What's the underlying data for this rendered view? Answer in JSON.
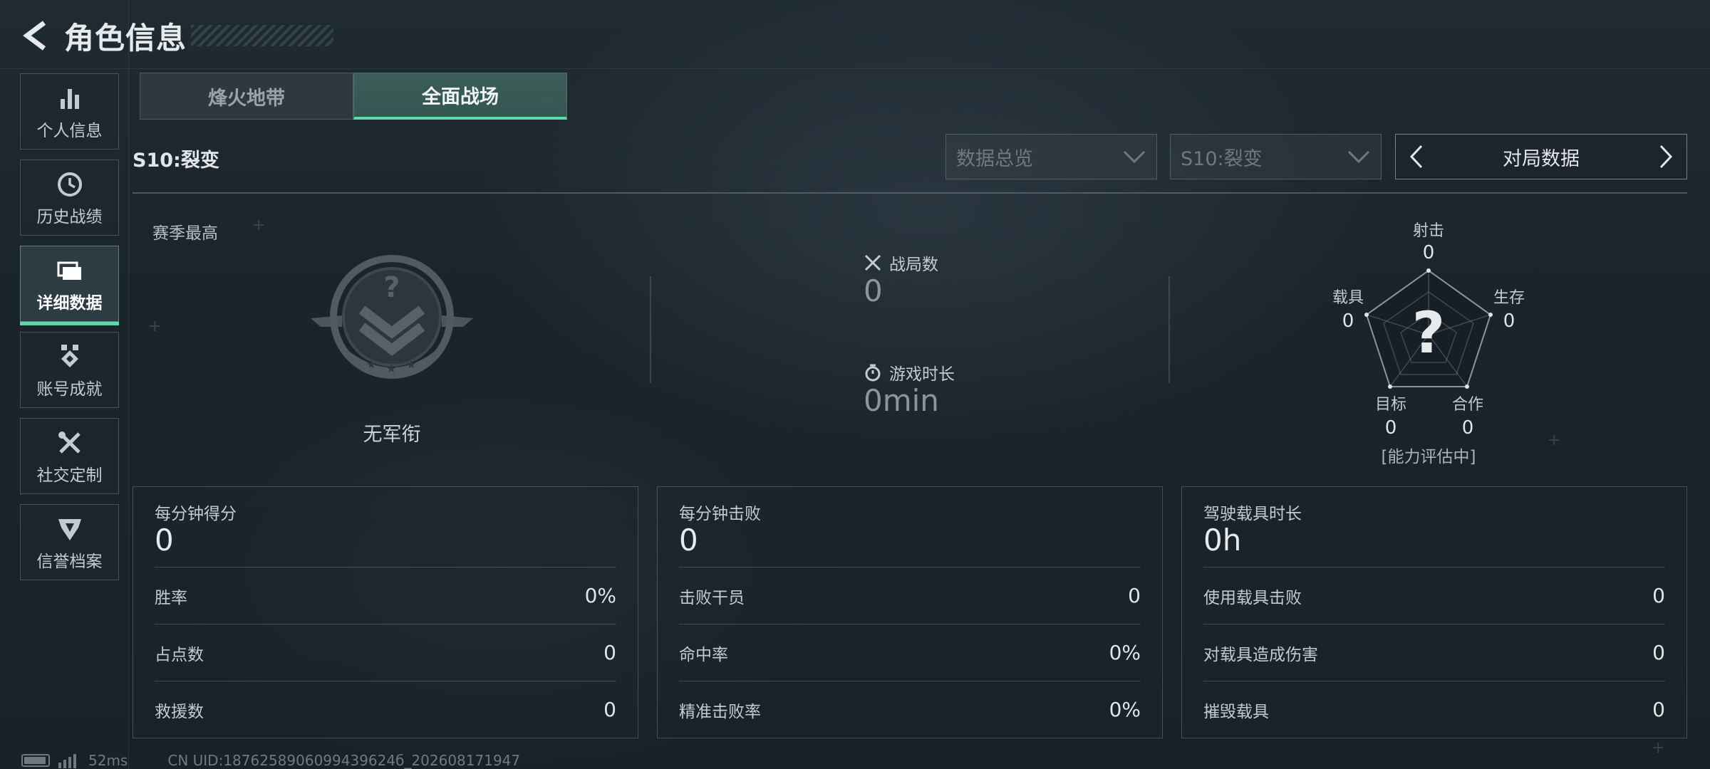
{
  "header": {
    "title": "角色信息"
  },
  "sidebar": {
    "items": [
      {
        "label": "个人信息"
      },
      {
        "label": "历史战绩"
      },
      {
        "label": "详细数据"
      },
      {
        "label": "账号成就"
      },
      {
        "label": "社交定制"
      },
      {
        "label": "信誉档案"
      }
    ],
    "active_index": 2
  },
  "tabs": [
    {
      "label": "烽火地带"
    },
    {
      "label": "全面战场"
    }
  ],
  "active_tab": 1,
  "season": {
    "label": "S10:裂变",
    "dropdown_overview": "数据总览",
    "dropdown_season": "S10:裂变",
    "match_data_label": "对局数据"
  },
  "overview": {
    "season_high_label": "赛季最高",
    "rank_name": "无军衔",
    "battles_label": "战局数",
    "battles_value": "0",
    "playtime_label": "游戏时长",
    "playtime_value": "0min"
  },
  "radar": {
    "shooting_label": "射击",
    "shooting_value": "0",
    "survival_label": "生存",
    "survival_value": "0",
    "teamwork_label": "合作",
    "teamwork_value": "0",
    "objective_label": "目标",
    "objective_value": "0",
    "vehicle_label": "载具",
    "vehicle_value": "0",
    "center_symbol": "?",
    "status": "[能力评估中]"
  },
  "cards": [
    {
      "title": "每分钟得分",
      "value": "0",
      "rows": [
        {
          "label": "胜率",
          "value": "0%"
        },
        {
          "label": "占点数",
          "value": "0"
        },
        {
          "label": "救援数",
          "value": "0"
        }
      ]
    },
    {
      "title": "每分钟击败",
      "value": "0",
      "rows": [
        {
          "label": "击败干员",
          "value": "0"
        },
        {
          "label": "命中率",
          "value": "0%"
        },
        {
          "label": "精准击败率",
          "value": "0%"
        }
      ]
    },
    {
      "title": "驾驶载具时长",
      "value": "0h",
      "rows": [
        {
          "label": "使用载具击败",
          "value": "0"
        },
        {
          "label": "对载具造成伤害",
          "value": "0"
        },
        {
          "label": "摧毁载具",
          "value": "0"
        }
      ]
    }
  ],
  "footer": {
    "ping": "52ms",
    "uid": "CN UID:1876258906099439624б_202608171947"
  },
  "colors": {
    "accent": "#62d6a4",
    "background": "#1c262e"
  }
}
